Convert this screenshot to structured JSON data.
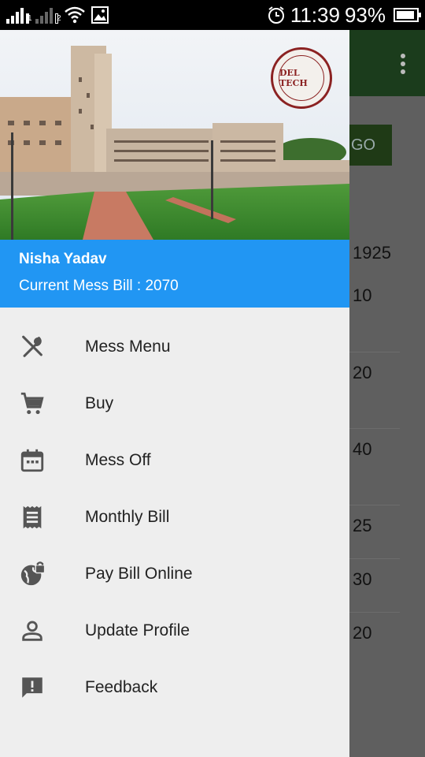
{
  "status": {
    "time": "11:39",
    "battery_percent": "93%",
    "battery_level": 0.93,
    "sim1": "1",
    "sim2": "2"
  },
  "background_app": {
    "go_label": "GO",
    "values": [
      "1925",
      "10",
      "20",
      "40",
      "25",
      "30",
      "20"
    ]
  },
  "drawer": {
    "logo_text": "DEL TECH",
    "user_name": "Nisha Yadav",
    "mess_bill": "Current Mess Bill : 2070",
    "items": [
      {
        "label": "Mess Menu",
        "icon": "fork-spoon-icon"
      },
      {
        "label": "Buy",
        "icon": "cart-icon"
      },
      {
        "label": "Mess Off",
        "icon": "calendar-icon"
      },
      {
        "label": "Monthly Bill",
        "icon": "receipt-icon"
      },
      {
        "label": "Pay Bill Online",
        "icon": "globe-lock-icon"
      },
      {
        "label": "Update Profile",
        "icon": "person-icon"
      },
      {
        "label": "Feedback",
        "icon": "feedback-icon"
      }
    ]
  },
  "colors": {
    "header_blue": "#2196f3",
    "drawer_bg": "#eeeeee",
    "toolbar_green": "#1b3c1c"
  }
}
